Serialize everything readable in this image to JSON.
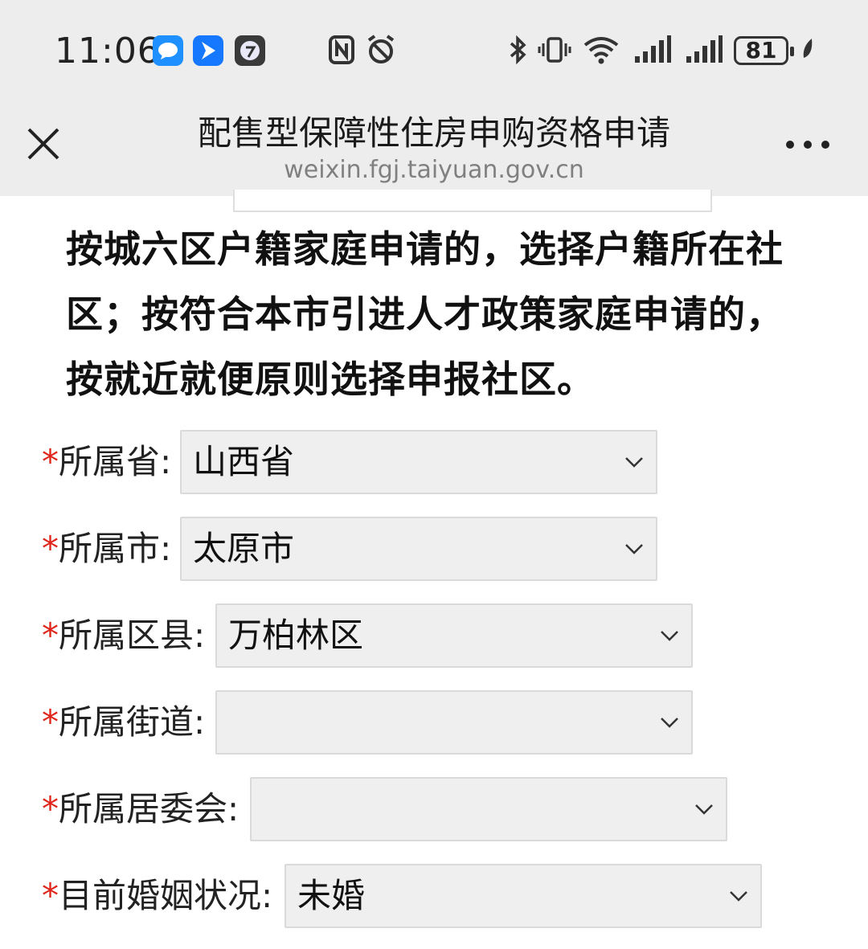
{
  "status_bar": {
    "time": "11:06",
    "battery": "81",
    "icons": [
      "message-icon",
      "bird-icon",
      "app-icon",
      "nfc-icon",
      "alarm-icon",
      "bluetooth-icon",
      "vibrate-icon",
      "wifi-icon",
      "signal-icon",
      "signal-icon",
      "leaf-icon"
    ]
  },
  "header": {
    "title": "配售型保障性住房申购资格申请",
    "url": "weixin.fgj.taiyuan.gov.cn"
  },
  "notice": {
    "lines": [
      "按城六区户籍家庭申请的，选择户籍所在社",
      "区；按符合本市引进人才政策家庭申请的，",
      "按就近就便原则选择申报社区。"
    ]
  },
  "form": {
    "required_mark": "*",
    "fields": [
      {
        "label": "所属省:",
        "value": "山西省"
      },
      {
        "label": "所属市:",
        "value": "太原市"
      },
      {
        "label": "所属区县:",
        "value": "万柏林区"
      },
      {
        "label": "所属街道:",
        "value": ""
      },
      {
        "label": "所属居委会:",
        "value": ""
      },
      {
        "label": "目前婚姻状况:",
        "value": "未婚"
      }
    ]
  },
  "colors": {
    "required": "#e0251b",
    "header_bg": "#ededed",
    "select_bg": "#efefef"
  }
}
